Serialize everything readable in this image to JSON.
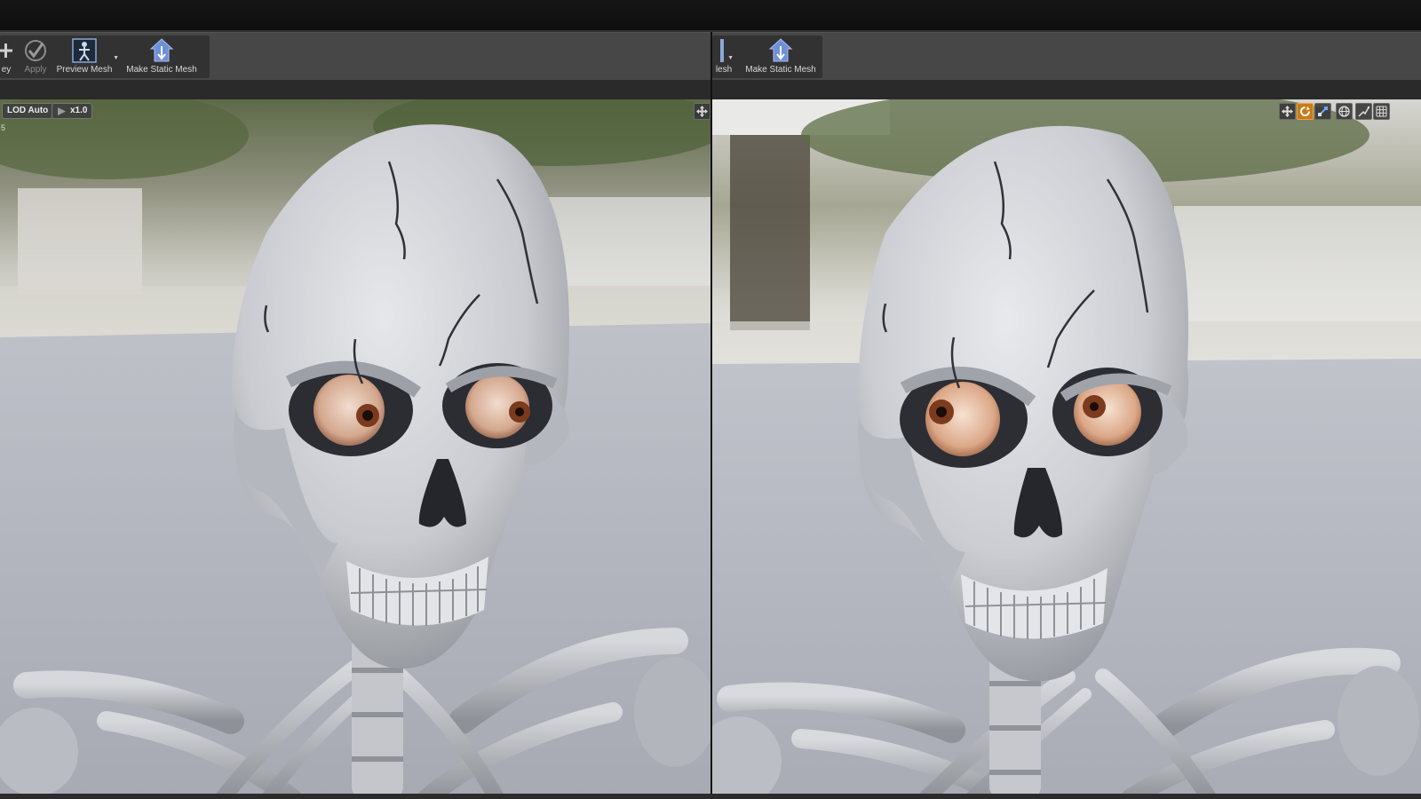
{
  "left_panel": {
    "toolbar": {
      "partial_label": "ey",
      "apply_label": "Apply",
      "preview_mesh_label": "Preview Mesh",
      "make_static_mesh_label": "Make Static Mesh"
    },
    "viewport": {
      "lod_label": "LOD Auto",
      "speed_label": "x1.0",
      "stat_partial": "5"
    }
  },
  "right_panel": {
    "toolbar": {
      "partial_label": "lesh",
      "make_static_mesh_label": "Make Static Mesh"
    }
  },
  "colors": {
    "toolbar_bg": "#474747",
    "button_group_bg": "#323232",
    "active_mode": "#c87a1a",
    "floor": "#b7b9c2",
    "bone": "#d2d4d8"
  },
  "icons": {
    "add": "plus-icon",
    "apply": "checkmark-icon",
    "preview_mesh": "preview-mesh-icon",
    "make_static_mesh": "house-arrow-icon",
    "play": "play-icon",
    "translate": "move-arrows-icon",
    "rotate": "rotate-icon",
    "scale": "scale-icon",
    "world": "globe-icon",
    "snap": "snap-icon",
    "grid": "grid-icon"
  }
}
